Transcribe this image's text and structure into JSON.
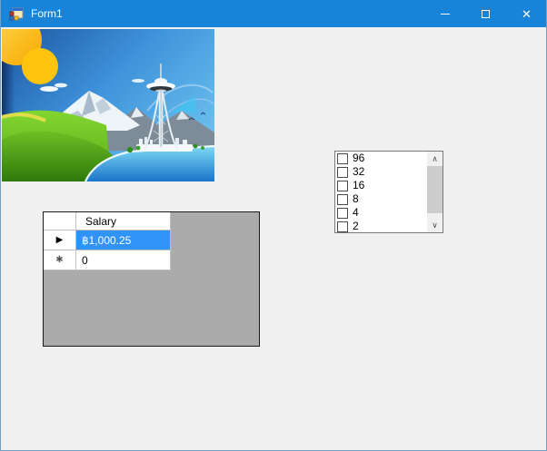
{
  "window": {
    "title": "Form1"
  },
  "icons": {
    "form": "winforms-window-icon",
    "minimize": "minimize-bar",
    "maximize": "maximize-square",
    "close": "✕",
    "scroll_up": "∧",
    "scroll_down": "∨",
    "current_row": "▶",
    "new_row": "✱"
  },
  "picture": {
    "alt": "Landscape illustration with sun, snowy mountain, green hills, lake and Seattle Space Needle"
  },
  "grid": {
    "column_header": "Salary",
    "rows": [
      {
        "indicator": "current",
        "value": "฿1,000.25",
        "selected": true
      },
      {
        "indicator": "new",
        "value": "0",
        "selected": false
      }
    ]
  },
  "checklist": {
    "items": [
      "96",
      "32",
      "16",
      "8",
      "4",
      "2"
    ]
  },
  "colors": {
    "titlebar": "#1884D9",
    "window_border": "#76A0C2",
    "form_background": "#F0F0F0",
    "grid_background": "#ABABAB",
    "selection": "#3094F7",
    "scroll_thumb": "#CDCDCD"
  }
}
